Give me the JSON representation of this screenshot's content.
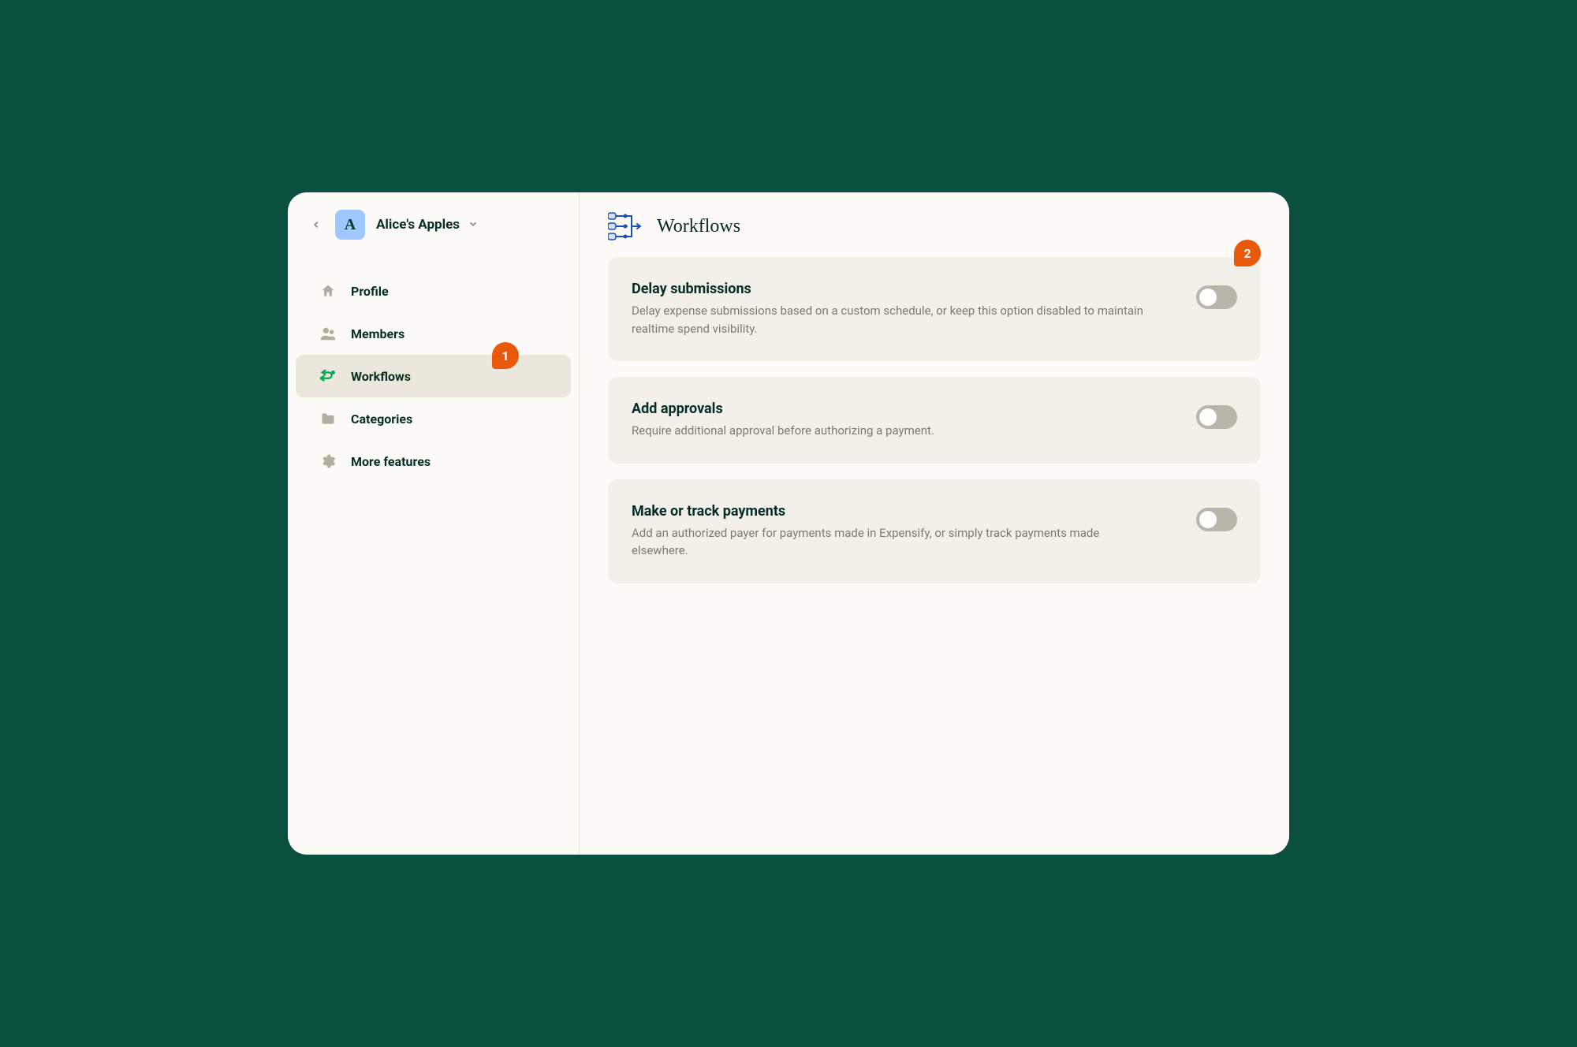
{
  "workspace": {
    "initial": "A",
    "name": "Alice's Apples"
  },
  "sidebar": {
    "items": [
      {
        "label": "Profile"
      },
      {
        "label": "Members"
      },
      {
        "label": "Workflows"
      },
      {
        "label": "Categories"
      },
      {
        "label": "More features"
      }
    ]
  },
  "page": {
    "title": "Workflows"
  },
  "cards": [
    {
      "title": "Delay submissions",
      "desc": "Delay expense submissions based on a custom schedule, or keep this option disabled to maintain realtime spend visibility.",
      "toggle": false
    },
    {
      "title": "Add approvals",
      "desc": "Require additional approval before authorizing a payment.",
      "toggle": false
    },
    {
      "title": "Make or track payments",
      "desc": "Add an authorized payer for payments made in Expensify, or simply track payments made elsewhere.",
      "toggle": false
    }
  ],
  "callouts": {
    "one": "1",
    "two": "2"
  }
}
